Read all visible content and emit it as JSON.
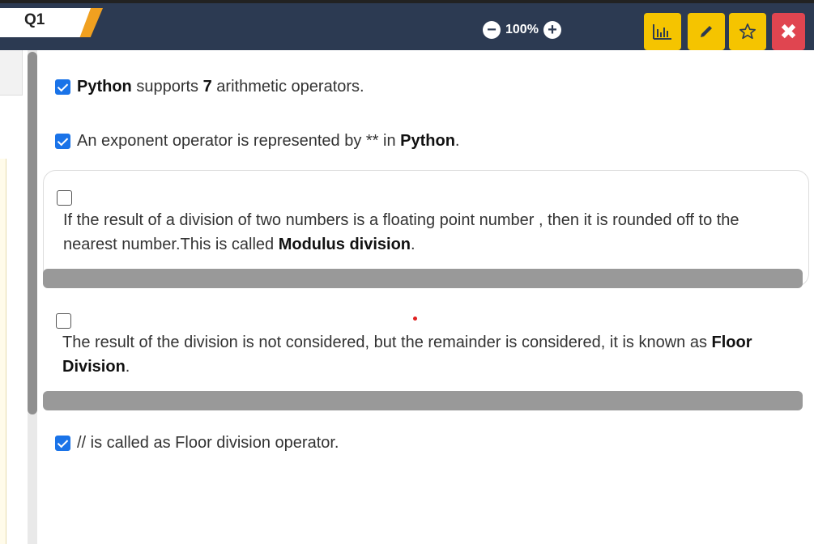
{
  "header": {
    "question_tab": "Q1",
    "zoom_level": "100%"
  },
  "toolbar": {
    "buttons": [
      "chart-icon",
      "pencil-icon",
      "star-icon",
      "close-icon"
    ],
    "colors": {
      "accent": "#f5c400",
      "close": "#e04550",
      "bar": "#2c3a52"
    }
  },
  "statements": {
    "s1": {
      "checked": true,
      "part1": "Python",
      "part2": " supports ",
      "part3": "7",
      "part4": " arithmetic operators."
    },
    "s2": {
      "checked": true,
      "part1": "An exponent operator is represented by ** in ",
      "part2": "Python",
      "part3": "."
    },
    "s3": {
      "checked": false,
      "part1": "If the result of a division of two numbers is a floating point number , then it is rounded off to the nearest number.This is called ",
      "part2": "Modulus division",
      "part3": "."
    },
    "s4": {
      "checked": false,
      "part1": "The result of the division is not considered, but the remainder is considered, it is known as ",
      "part2": "Floor Division",
      "part3": "."
    },
    "s5": {
      "checked": true,
      "part1": "// is called as Floor division operator."
    }
  }
}
